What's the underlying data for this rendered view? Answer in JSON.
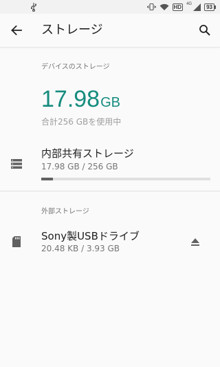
{
  "status": {
    "hd": "HD",
    "network": "4G",
    "battery": "93"
  },
  "appbar": {
    "title": "ストレージ"
  },
  "device_storage": {
    "header": "デバイスのストレージ",
    "used_value": "17.98",
    "used_unit": "GB",
    "total_caption": "合計256 GBを使用中"
  },
  "internal": {
    "title": "内部共有ストレージ",
    "usage": "17.98 GB / 256 GB",
    "used_fraction": 0.0702
  },
  "external": {
    "header": "外部ストレージ",
    "title": "Sony製USBドライブ",
    "usage": "20.48 KB / 3.93 GB"
  },
  "colors": {
    "accent": "#168c7e",
    "progress_fill": "#616161",
    "progress_track": "#e0e0e0"
  },
  "icons": {
    "back": "arrow-back-icon",
    "search": "search-icon",
    "internal": "storage-icon",
    "external": "sd-card-icon",
    "eject": "eject-icon"
  }
}
